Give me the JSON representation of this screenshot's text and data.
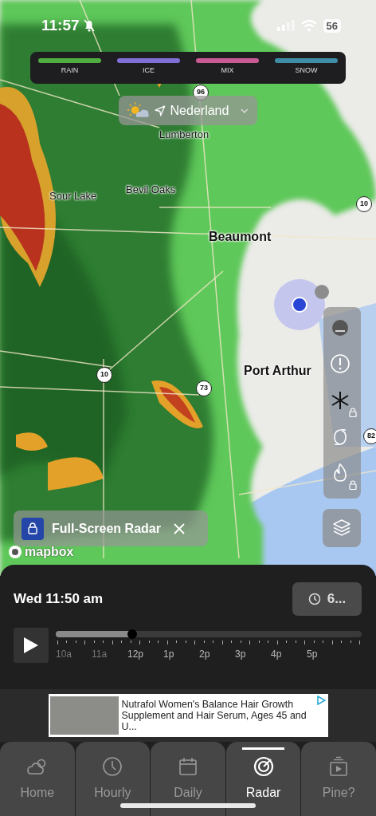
{
  "status_bar": {
    "time": "11:57",
    "battery": "56",
    "silenced": true
  },
  "legend": [
    {
      "label": "RAIN",
      "color": "#4fae3f"
    },
    {
      "label": "ICE",
      "color": "#7f6fd6"
    },
    {
      "label": "MIX",
      "color": "#c95a94"
    },
    {
      "label": "SNOW",
      "color": "#3f8ea8"
    }
  ],
  "location": {
    "name": "Nederland"
  },
  "map_labels": [
    {
      "kind": "city",
      "text": "Lumberton"
    },
    {
      "kind": "city",
      "text": "Sour Lake"
    },
    {
      "kind": "city",
      "text": "Bevil Oaks"
    },
    {
      "kind": "major",
      "text": "Beaumont"
    },
    {
      "kind": "major",
      "text": "Port Arthur"
    },
    {
      "kind": "shield",
      "text": "96"
    },
    {
      "kind": "shield",
      "text": "10"
    },
    {
      "kind": "shield",
      "text": "10"
    },
    {
      "kind": "shield",
      "text": "73"
    },
    {
      "kind": "shield",
      "text": "82"
    }
  ],
  "map_tools": [
    {
      "kind": "radar",
      "locked": false
    },
    {
      "kind": "alert",
      "locked": false
    },
    {
      "kind": "snow",
      "locked": true
    },
    {
      "kind": "hurricane",
      "locked": false
    },
    {
      "kind": "fire",
      "locked": true
    }
  ],
  "promo": {
    "label": "Full-Screen Radar"
  },
  "attribution": "mapbox",
  "timeline": {
    "time": "Wed 11:50 am",
    "duration": "6...",
    "level": 0.25,
    "ticks": [
      {
        "label": "10a",
        "past": true
      },
      {
        "label": "11a",
        "past": true
      },
      {
        "label": "12p",
        "past": false
      },
      {
        "label": "1p",
        "past": false
      },
      {
        "label": "2p",
        "past": false
      },
      {
        "label": "3p",
        "past": false
      },
      {
        "label": "4p",
        "past": false
      },
      {
        "label": "5p",
        "past": false
      }
    ]
  },
  "ad": {
    "title": "Nutrafol Women's Balance Hair Growth Supplement and Hair Serum, Ages 45 and U..."
  },
  "tabs": [
    {
      "kind": "home",
      "label": "Home",
      "selected": false
    },
    {
      "kind": "hourly",
      "label": "Hourly",
      "selected": false
    },
    {
      "kind": "daily",
      "label": "Daily",
      "selected": false
    },
    {
      "kind": "radar",
      "label": "Radar",
      "selected": true
    },
    {
      "kind": "video",
      "label": "Pine?",
      "selected": false
    }
  ]
}
